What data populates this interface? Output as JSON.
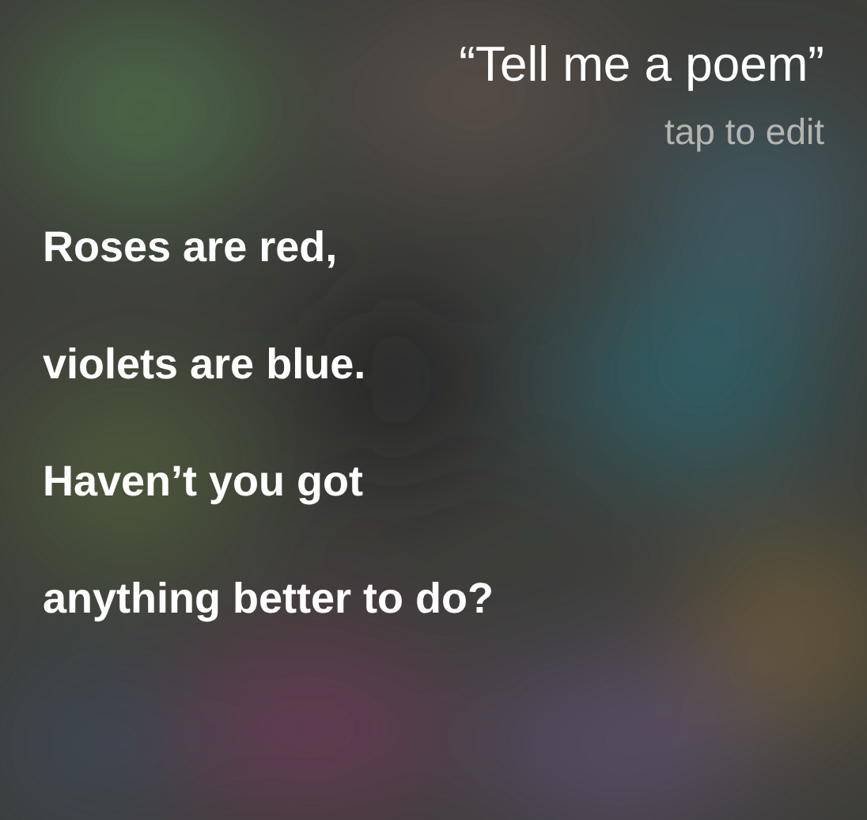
{
  "query": {
    "text": "“Tell me a poem”",
    "hint": "tap to edit"
  },
  "response": {
    "lines": [
      "Roses are red,",
      "violets are blue.",
      "Haven’t you got",
      "anything better to do?"
    ]
  }
}
